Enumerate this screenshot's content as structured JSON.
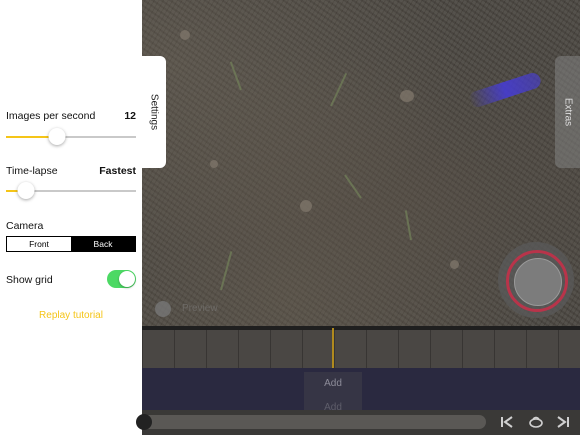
{
  "settings": {
    "tab_label": "Settings",
    "images_per_second": {
      "label": "Images per second",
      "value": "12",
      "level": 0.39
    },
    "time_lapse": {
      "label": "Time-lapse",
      "value": "Fastest",
      "level": 0.15
    },
    "camera": {
      "label": "Camera",
      "options": [
        "Front",
        "Back"
      ],
      "selected": "Back"
    },
    "show_grid": {
      "label": "Show grid",
      "enabled": true
    },
    "replay_tutorial": "Replay tutorial"
  },
  "extras": {
    "tab_label": "Extras"
  },
  "preview": {
    "label": "Preview"
  },
  "timeline": {
    "add_label": "Add",
    "add_label_faded": "Add"
  },
  "icons": {
    "shutter": "shutter-button-icon",
    "rewind": "skip-to-start-icon",
    "onion": "onion-skin-icon",
    "play": "play-icon"
  },
  "colors": {
    "accent": "#f5c518",
    "toggle_on": "#4cd964",
    "shutter_ring": "#b8344a"
  }
}
